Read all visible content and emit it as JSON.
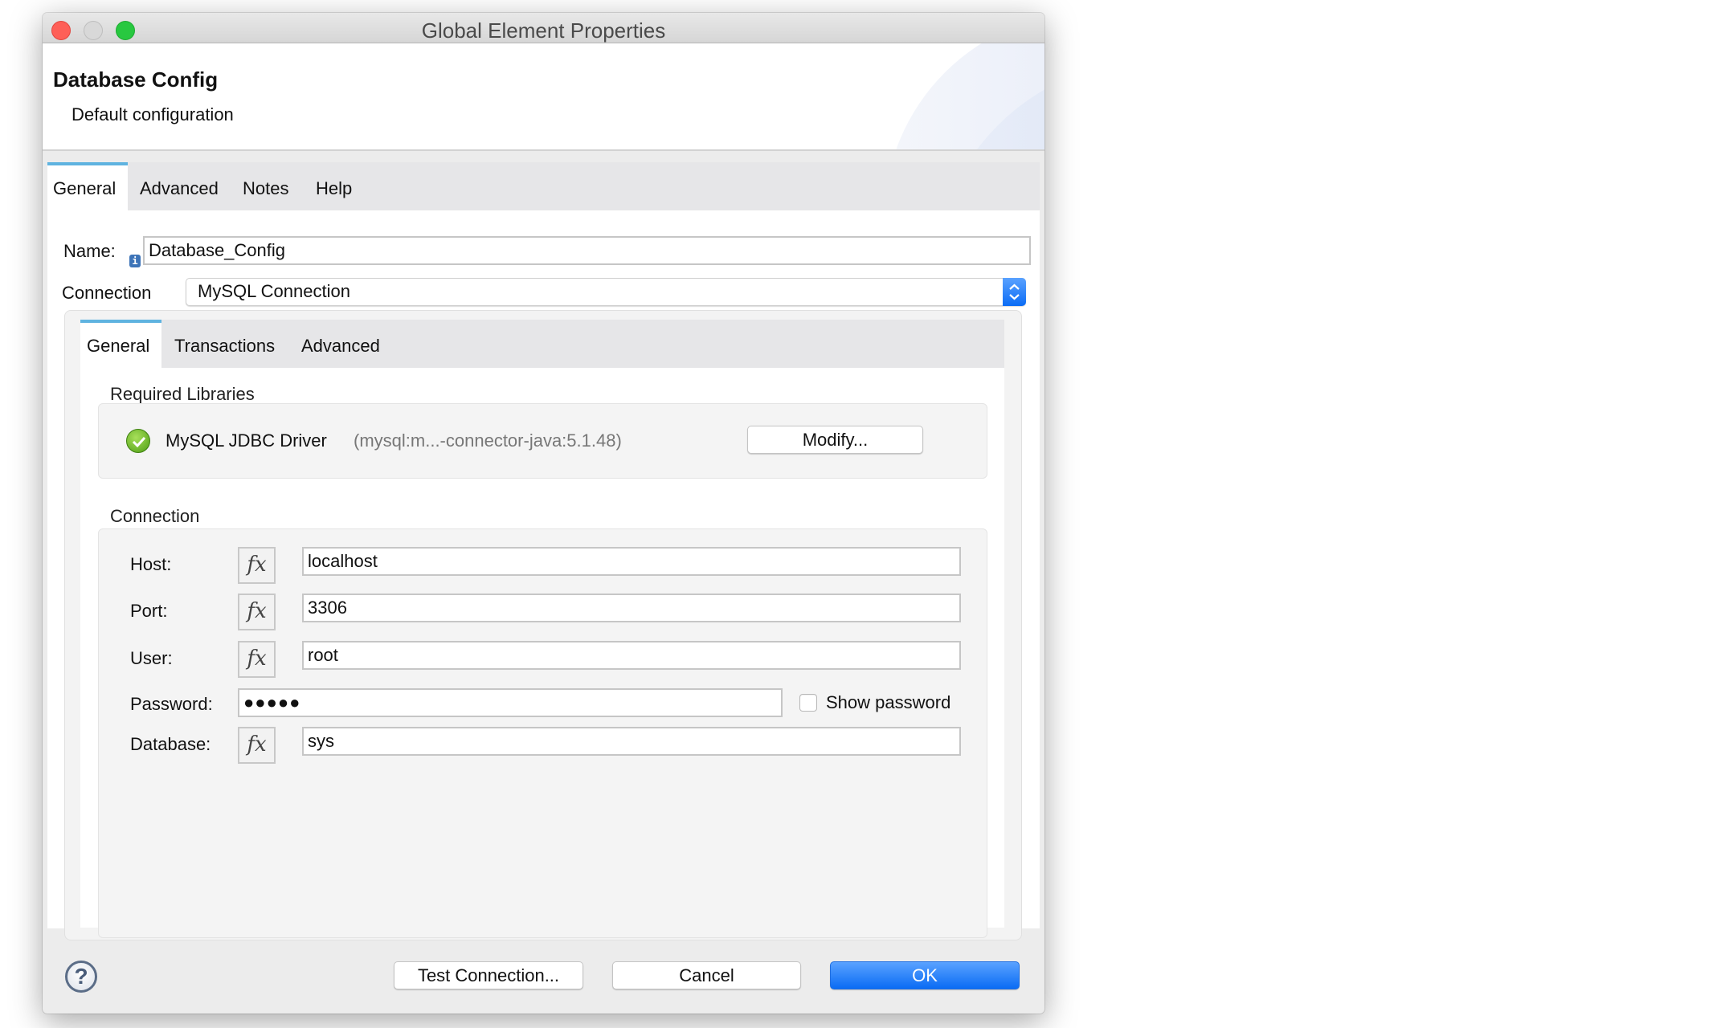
{
  "window": {
    "title": "Global Element Properties"
  },
  "header": {
    "title": "Database Config",
    "subtitle": "Default configuration"
  },
  "tabs": [
    {
      "label": "General",
      "active": true
    },
    {
      "label": "Advanced",
      "active": false
    },
    {
      "label": "Notes",
      "active": false
    },
    {
      "label": "Help",
      "active": false
    }
  ],
  "form": {
    "name_label": "Name:",
    "name_value": "Database_Config",
    "info_icon_glyph": "i",
    "connection_label": "Connection",
    "connection_value": "MySQL Connection"
  },
  "inner_tabs": [
    {
      "label": "General",
      "active": true
    },
    {
      "label": "Transactions",
      "active": false
    },
    {
      "label": "Advanced",
      "active": false
    }
  ],
  "required_libraries": {
    "section_label": "Required Libraries",
    "library_name": "MySQL JDBC Driver",
    "library_coords": "(mysql:m...-connector-java:5.1.48)",
    "status_icon": "check-circle-icon",
    "modify_label": "Modify..."
  },
  "connection": {
    "section_label": "Connection",
    "fx_glyph": "fx",
    "host": {
      "label": "Host:",
      "value": "localhost"
    },
    "port": {
      "label": "Port:",
      "value": "3306"
    },
    "user": {
      "label": "User:",
      "value": "root"
    },
    "password": {
      "label": "Password:",
      "value": "●●●●●",
      "show_password_label": "Show password",
      "show_password_checked": false
    },
    "database": {
      "label": "Database:",
      "value": "sys"
    }
  },
  "footer": {
    "help_glyph": "?",
    "test_connection_label": "Test Connection...",
    "cancel_label": "Cancel",
    "ok_label": "OK"
  },
  "colors": {
    "accent": "#0a6cf4",
    "tab_indicator": "#5fb3e0",
    "close": "#fe5f57",
    "maximize": "#28c840",
    "success": "#4e9e14"
  }
}
